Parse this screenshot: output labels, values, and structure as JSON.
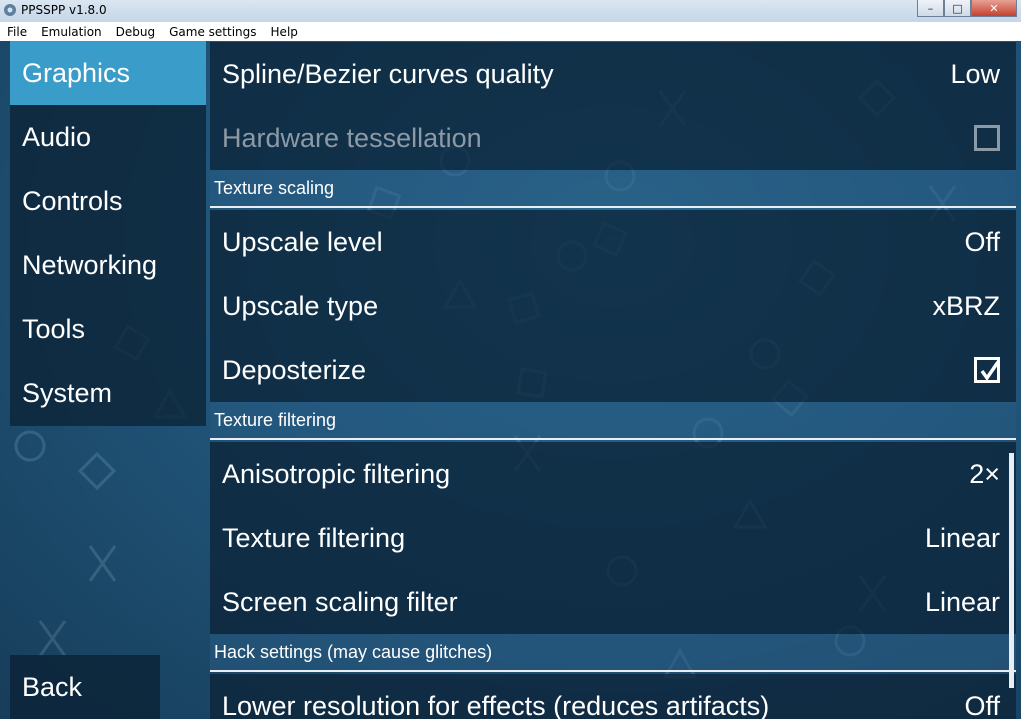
{
  "window": {
    "title": "PPSSPP v1.8.0",
    "controls": {
      "minimize": "–",
      "maximize": "□",
      "close": "✕"
    }
  },
  "menu": [
    "File",
    "Emulation",
    "Debug",
    "Game settings",
    "Help"
  ],
  "sidebar": {
    "items": [
      {
        "label": "Graphics",
        "active": true
      },
      {
        "label": "Audio"
      },
      {
        "label": "Controls"
      },
      {
        "label": "Networking"
      },
      {
        "label": "Tools"
      },
      {
        "label": "System"
      }
    ],
    "back_label": "Back"
  },
  "settings": {
    "spline_quality": {
      "label": "Spline/Bezier curves quality",
      "value": "Low"
    },
    "hw_tessellation": {
      "label": "Hardware tessellation",
      "checked": false,
      "disabled": true
    },
    "texture_scaling": {
      "header": "Texture scaling",
      "upscale_level": {
        "label": "Upscale level",
        "value": "Off"
      },
      "upscale_type": {
        "label": "Upscale type",
        "value": "xBRZ"
      },
      "deposterize": {
        "label": "Deposterize",
        "checked": true
      }
    },
    "texture_filtering": {
      "header": "Texture filtering",
      "anisotropic": {
        "label": "Anisotropic filtering",
        "value": "2×"
      },
      "texture_filter": {
        "label": "Texture filtering",
        "value": "Linear"
      },
      "screen_scaling": {
        "label": "Screen scaling filter",
        "value": "Linear"
      }
    },
    "hacks": {
      "header": "Hack settings (may cause glitches)",
      "lower_res": {
        "label": "Lower resolution for effects (reduces artifacts)",
        "value": "Off"
      }
    }
  },
  "icons": {
    "app": "ppsspp-app-icon",
    "checkbox_empty": "checkbox-empty-icon",
    "checkbox_checked": "checkbox-checked-icon"
  },
  "colors": {
    "accent": "#3a9cc8",
    "row_bg": "#0c2438",
    "background": "#21577c"
  }
}
